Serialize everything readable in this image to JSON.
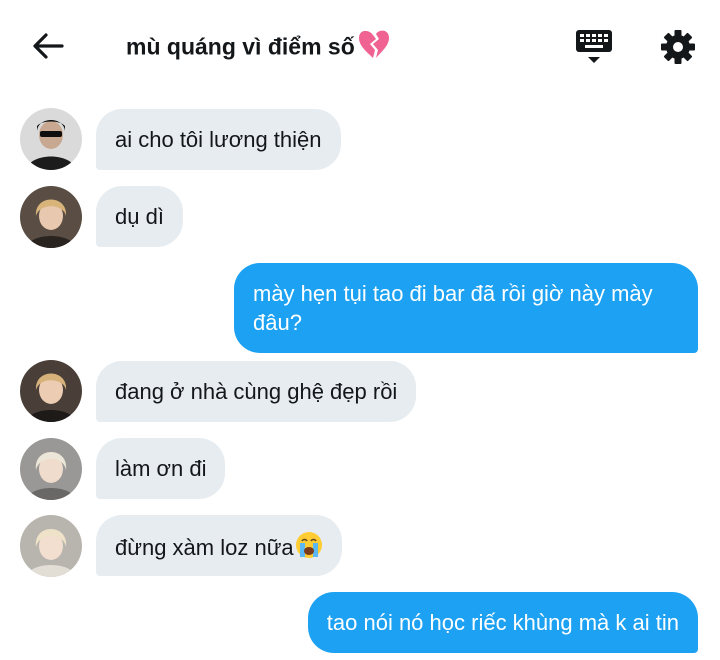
{
  "header": {
    "title": "mù quáng vì điểm số",
    "title_emoji": "broken-heart-emoji",
    "back_icon": "arrow-left-icon",
    "keyboard_icon": "keyboard-icon",
    "settings_icon": "gear-icon"
  },
  "colors": {
    "outgoing_bubble": "#1da1f2",
    "incoming_bubble": "#e6ecf0",
    "text": "#14171a",
    "heart": "#f06292"
  },
  "messages": [
    {
      "direction": "incoming",
      "text": "ai cho tôi lương thiện"
    },
    {
      "direction": "incoming",
      "text": "dụ dì"
    },
    {
      "direction": "outgoing",
      "text": "mày hẹn tụi tao đi bar đã rồi giờ này mày đâu?"
    },
    {
      "direction": "incoming",
      "text": "đang ở nhà cùng ghệ đẹp rồi"
    },
    {
      "direction": "incoming",
      "text": "làm ơn đi"
    },
    {
      "direction": "incoming",
      "text": "đừng xàm loz nữa",
      "emoji": "loudly-crying-face-emoji"
    },
    {
      "direction": "outgoing",
      "text": "tao nói nó học riếc khùng mà k ai tin"
    }
  ]
}
